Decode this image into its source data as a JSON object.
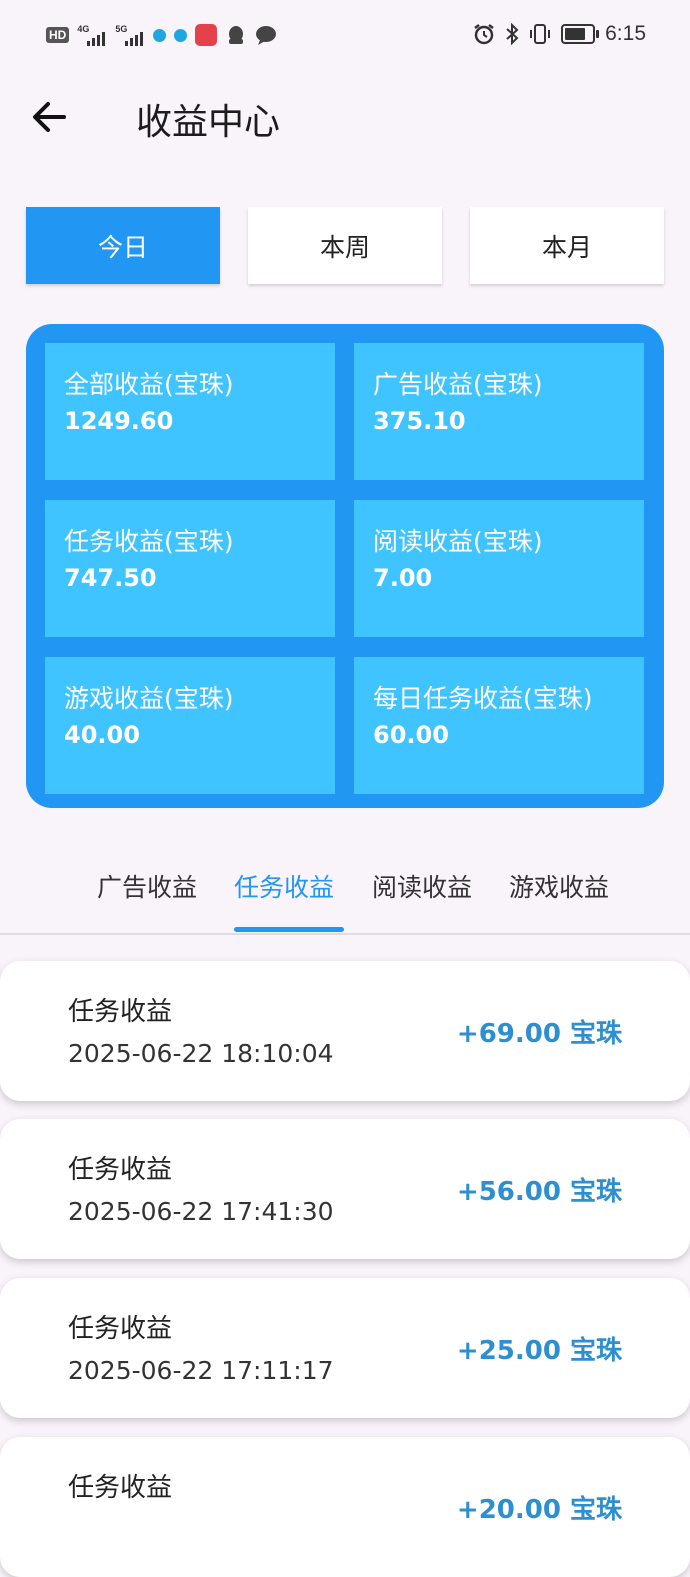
{
  "status_bar": {
    "hd_badge": "HD",
    "net1_label": "4G",
    "net2_label": "5G",
    "time": "6:15",
    "battery_level": 0.75,
    "icons": [
      "signal-icon",
      "alarm-icon",
      "bluetooth-icon",
      "vibrate-icon",
      "battery-icon"
    ]
  },
  "header": {
    "title": "收益中心",
    "back_icon": "arrow-left-icon"
  },
  "period_tabs": [
    {
      "label": "今日",
      "active": true
    },
    {
      "label": "本周",
      "active": false
    },
    {
      "label": "本月",
      "active": false
    }
  ],
  "summary": {
    "items": [
      {
        "label": "全部收益(宝珠)",
        "value": "1249.60"
      },
      {
        "label": "广告收益(宝珠)",
        "value": "375.10"
      },
      {
        "label": "任务收益(宝珠)",
        "value": "747.50"
      },
      {
        "label": "阅读收益(宝珠)",
        "value": "7.00"
      },
      {
        "label": "游戏收益(宝珠)",
        "value": "40.00"
      },
      {
        "label": "每日任务收益(宝珠)",
        "value": "60.00"
      }
    ]
  },
  "category_tabs": {
    "items": [
      "广告收益",
      "任务收益",
      "阅读收益",
      "游戏收益"
    ],
    "active_index": 1
  },
  "records": [
    {
      "title": "任务收益",
      "time": "2025-06-22 18:10:04",
      "amount": "+69.00 宝珠"
    },
    {
      "title": "任务收益",
      "time": "2025-06-22 17:41:30",
      "amount": "+56.00 宝珠"
    },
    {
      "title": "任务收益",
      "time": "2025-06-22 17:11:17",
      "amount": "+25.00 宝珠"
    },
    {
      "title": "任务收益",
      "time": "",
      "amount": "+20.00 宝珠"
    }
  ],
  "colors": {
    "accent": "#2196f3",
    "stat_cell": "#40c4ff",
    "amount": "#2e8fd0",
    "background": "#f9f3fa"
  }
}
